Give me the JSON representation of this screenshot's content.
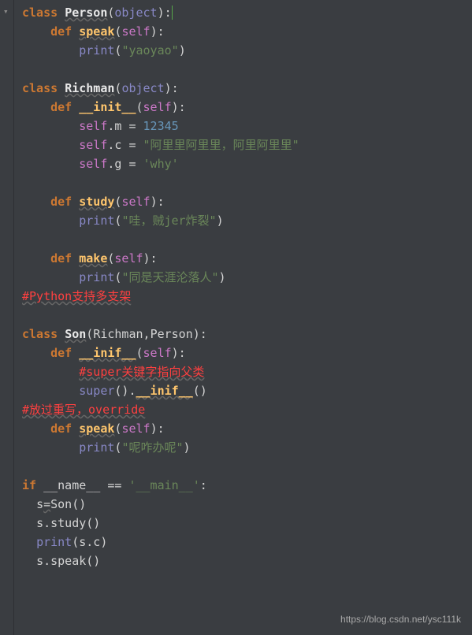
{
  "watermark": "https://blog.csdn.net/ysc111k",
  "code": {
    "l1": {
      "kw1": "class",
      "cls": "Person",
      "p1": "(",
      "bi": "object",
      "p2": "):"
    },
    "l2": {
      "kw": "def",
      "fn": "speak",
      "p1": "(",
      "self": "self",
      "p2": "):"
    },
    "l3": {
      "bi": "print",
      "p1": "(",
      "str": "\"yaoyao\"",
      "p2": ")"
    },
    "l4": {
      "kw": "class",
      "cls": "Richman",
      "p1": "(",
      "bi": "object",
      "p2": "):"
    },
    "l5": {
      "kw": "def",
      "fn": "__init__",
      "p1": "(",
      "self": "self",
      "p2": "):"
    },
    "l6": {
      "self": "self",
      "dot": ".",
      "attr": "m = ",
      "num": "12345"
    },
    "l7": {
      "self": "self",
      "dot": ".",
      "attr": "c = ",
      "str": "\"阿里里阿里里，阿里阿里里\""
    },
    "l8": {
      "self": "self",
      "dot": ".",
      "attr": "g = ",
      "str": "'why'"
    },
    "l9": {
      "kw": "def",
      "fn": "study",
      "p1": "(",
      "self": "self",
      "p2": "):"
    },
    "l10": {
      "bi": "print",
      "p1": "(",
      "str": "\"哇，贼jer炸裂\"",
      "p2": ")"
    },
    "l11": {
      "kw": "def",
      "fn": "make",
      "p1": "(",
      "self": "self",
      "p2": "):"
    },
    "l12": {
      "bi": "print",
      "p1": "(",
      "str": "\"同是天涯沦落人\"",
      "p2": ")"
    },
    "l13": {
      "c": "#Python支持多支架"
    },
    "l14": {
      "kw": "class",
      "cls": "Son",
      "p1": "(",
      "a1": "Richman",
      "comma": ",",
      "a2": "Person",
      "p2": "):"
    },
    "l15": {
      "kw": "def",
      "fn": "__inif__",
      "p1": "(",
      "self": "self",
      "p2": "):"
    },
    "l16": {
      "c": "#super关键字指向父类"
    },
    "l17": {
      "bi": "super",
      "p1": "().",
      "fn": "__inif__",
      "p2": "()"
    },
    "l18": {
      "c": "#放过重写，override"
    },
    "l19": {
      "kw": "def",
      "fn": "speak",
      "p1": "(",
      "self": "self",
      "p2": "):"
    },
    "l20": {
      "bi": "print",
      "p1": "(",
      "str": "\"呢咋办呢\"",
      "p2": ")"
    },
    "l21": {
      "kw": "if",
      "name": "__name__",
      "eq": " == ",
      "str": "'__main__'",
      "colon": ":"
    },
    "l22": {
      "txt": "s",
      "eq": "=",
      "call": "Son()"
    },
    "l23": {
      "txt": "s.study()"
    },
    "l24": {
      "bi": "print",
      "p1": "(",
      "txt": "s.c",
      "p2": ")"
    },
    "l25": {
      "txt": "s.speak()"
    }
  }
}
